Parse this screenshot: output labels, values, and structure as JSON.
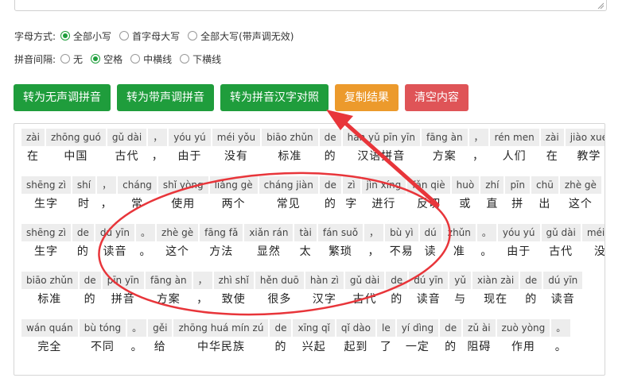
{
  "options": {
    "case": {
      "label": "字母方式:",
      "choices": [
        {
          "label": "全部小写",
          "checked": true
        },
        {
          "label": "首字母大写",
          "checked": false
        },
        {
          "label": "全部大写(带声调无效)",
          "checked": false
        }
      ]
    },
    "spacing": {
      "label": "拼音间隔:",
      "choices": [
        {
          "label": "无",
          "checked": false
        },
        {
          "label": "空格",
          "checked": true
        },
        {
          "label": "中横线",
          "checked": false
        },
        {
          "label": "下横线",
          "checked": false
        }
      ]
    }
  },
  "buttons": [
    {
      "label": "转为无声调拼音",
      "color": "#1f9d3c"
    },
    {
      "label": "转为带声调拼音",
      "color": "#1f9d3c"
    },
    {
      "label": "转为拼音汉字对照",
      "color": "#1f9d3c"
    },
    {
      "label": "复制结果",
      "color": "#ec9a2c"
    },
    {
      "label": "清空内容",
      "color": "#df5457"
    }
  ],
  "annotation_color": "#e8353a",
  "result": {
    "lines": [
      [
        {
          "py": "zài",
          "hz": "在"
        },
        {
          "py": "zhōng guó",
          "hz": "中国"
        },
        {
          "py": "gǔ dài",
          "hz": "古代"
        },
        {
          "py": "，",
          "hz": "，"
        },
        {
          "py": "yóu yú",
          "hz": "由于"
        },
        {
          "py": "méi yǒu",
          "hz": "没有"
        },
        {
          "py": "biāo zhǔn",
          "hz": "标准"
        },
        {
          "py": "de",
          "hz": "的"
        },
        {
          "py": "hàn yǔ pīn yīn",
          "hz": "汉语拼音"
        },
        {
          "py": "fāng àn",
          "hz": "方案"
        },
        {
          "py": "，",
          "hz": "，"
        },
        {
          "py": "rén men",
          "hz": "人们"
        },
        {
          "py": "zài",
          "hz": "在"
        },
        {
          "py": "jiào xué",
          "hz": "教学"
        }
      ],
      [
        {
          "py": "shēng zì",
          "hz": "生字"
        },
        {
          "py": "shí",
          "hz": "时"
        },
        {
          "py": "，",
          "hz": "，"
        },
        {
          "py": "cháng",
          "hz": "常"
        },
        {
          "py": "shǐ yòng",
          "hz": "使用"
        },
        {
          "py": "liǎng gè",
          "hz": "两个"
        },
        {
          "py": "cháng jiàn",
          "hz": "常见"
        },
        {
          "py": "de",
          "hz": "的"
        },
        {
          "py": "zì",
          "hz": "字"
        },
        {
          "py": "jìn xíng",
          "hz": "进行"
        },
        {
          "py": "fǎn qiè",
          "hz": "反切"
        },
        {
          "py": "huò",
          "hz": "或"
        },
        {
          "py": "zhí",
          "hz": "直"
        },
        {
          "py": "pīn",
          "hz": "拼"
        },
        {
          "py": "chū",
          "hz": "出"
        },
        {
          "py": "zhè gè",
          "hz": "这个"
        }
      ],
      [
        {
          "py": "shēng zì",
          "hz": "生字"
        },
        {
          "py": "de",
          "hz": "的"
        },
        {
          "py": "dú yīn",
          "hz": "读音"
        },
        {
          "py": "。",
          "hz": "。"
        },
        {
          "py": "zhè gè",
          "hz": "这个"
        },
        {
          "py": "fāng fǎ",
          "hz": "方法"
        },
        {
          "py": "xiǎn rán",
          "hz": "显然"
        },
        {
          "py": "tài",
          "hz": "太"
        },
        {
          "py": "fán suǒ",
          "hz": "繁琐"
        },
        {
          "py": "，",
          "hz": "，"
        },
        {
          "py": "bù yì",
          "hz": "不易"
        },
        {
          "py": "dú",
          "hz": "读"
        },
        {
          "py": "zhǔn",
          "hz": "准"
        },
        {
          "py": "。",
          "hz": "。"
        },
        {
          "py": "yóu yú",
          "hz": "由于"
        },
        {
          "py": "gǔ dài",
          "hz": "古代"
        },
        {
          "py": "méi yǒu",
          "hz": "没有"
        }
      ],
      [
        {
          "py": "biāo zhǔn",
          "hz": "标准"
        },
        {
          "py": "de",
          "hz": "的"
        },
        {
          "py": "pīn yīn",
          "hz": "拼音"
        },
        {
          "py": "fāng àn",
          "hz": "方案"
        },
        {
          "py": "，",
          "hz": "，"
        },
        {
          "py": "zhì shǐ",
          "hz": "致使"
        },
        {
          "py": "hěn duō",
          "hz": "很多"
        },
        {
          "py": "hàn zì",
          "hz": "汉字"
        },
        {
          "py": "gǔ dài",
          "hz": "古代"
        },
        {
          "py": "de",
          "hz": "的"
        },
        {
          "py": "dú yīn",
          "hz": "读音"
        },
        {
          "py": "yǔ",
          "hz": "与"
        },
        {
          "py": "xiàn zài",
          "hz": "现在"
        },
        {
          "py": "de",
          "hz": "的"
        },
        {
          "py": "dú yīn",
          "hz": "读音"
        }
      ],
      [
        {
          "py": "wán quán",
          "hz": "完全"
        },
        {
          "py": "bù tóng",
          "hz": "不同"
        },
        {
          "py": "。",
          "hz": "。"
        },
        {
          "py": "gěi",
          "hz": "给"
        },
        {
          "py": "zhōng huá mín zú",
          "hz": "中华民族"
        },
        {
          "py": "de",
          "hz": "的"
        },
        {
          "py": "xīng qǐ",
          "hz": "兴起"
        },
        {
          "py": "qǐ dào",
          "hz": "起到"
        },
        {
          "py": "le",
          "hz": "了"
        },
        {
          "py": "yí dìng",
          "hz": "一定"
        },
        {
          "py": "de",
          "hz": "的"
        },
        {
          "py": "zǔ ài",
          "hz": "阻碍"
        },
        {
          "py": "zuò yòng",
          "hz": "作用"
        },
        {
          "py": "。",
          "hz": "。"
        }
      ]
    ]
  }
}
